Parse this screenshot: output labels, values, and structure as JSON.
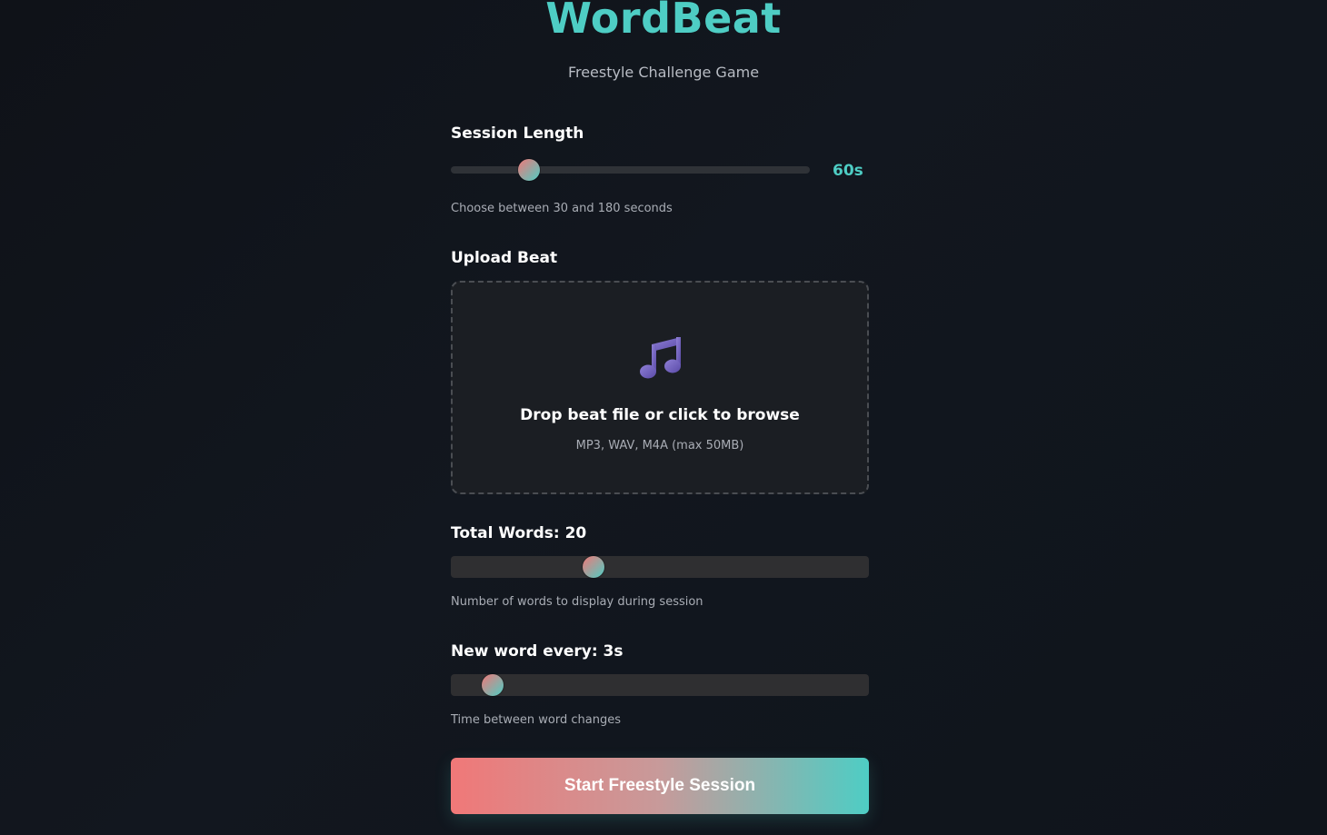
{
  "app": {
    "title": "WordBeat",
    "subtitle": "Freestyle Challenge Game"
  },
  "session_length": {
    "label": "Session Length",
    "value_display": "60s",
    "value": 60,
    "min": 30,
    "max": 180,
    "hint": "Choose between 30 and 180 seconds"
  },
  "upload": {
    "label": "Upload Beat",
    "icon": "music-note-icon",
    "title": "Drop beat file or click to browse",
    "hint": "MP3, WAV, M4A (max 50MB)"
  },
  "total_words": {
    "label": "Total Words: 20",
    "value": 20,
    "hint": "Number of words to display during session"
  },
  "word_interval": {
    "label": "New word every: 3s",
    "value": 3,
    "hint": "Time between word changes"
  },
  "start_button": {
    "label": "Start Freestyle Session"
  },
  "colors": {
    "accent_teal": "#4ecdc4",
    "accent_coral": "#f07878",
    "background": "#11151c"
  }
}
